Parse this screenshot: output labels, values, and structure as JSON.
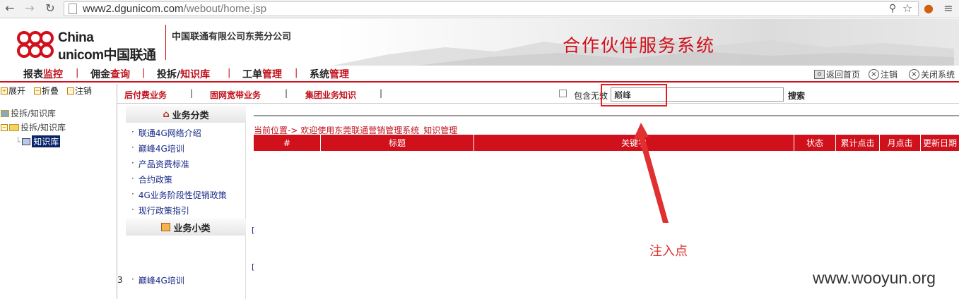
{
  "browser": {
    "url_host": "www2.dgunicom.com",
    "url_path": "/webout/home.jsp"
  },
  "header": {
    "logo_line1": "China",
    "logo_line2": "unicom中国联通",
    "company": "中国联通有限公司东莞分公司",
    "system_title": "合作伙伴服务系统"
  },
  "main_nav": {
    "items": [
      {
        "a": "报表",
        "b": "监控"
      },
      {
        "a": "佣金",
        "b": "查询"
      },
      {
        "a": "投拆/",
        "b": "知识库"
      },
      {
        "a": "工单",
        "b": "管理"
      },
      {
        "a": "系统",
        "b": "管理"
      }
    ],
    "sep": "|",
    "right_links": [
      "返回首页",
      "注销",
      "关闭系统"
    ]
  },
  "tree": {
    "toolbar": [
      "展开",
      "折叠",
      "注销"
    ],
    "nodes": [
      "投拆/知识库",
      "投拆/知识库",
      "知识库"
    ]
  },
  "sub_nav": {
    "items": [
      "后付费业务",
      "固网宽带业务",
      "集团业务知识"
    ],
    "sep": "|",
    "checkbox_label": "包含无效",
    "search_value": "巅峰",
    "search_button": "搜索"
  },
  "categories": {
    "head1": "业务分类",
    "items": [
      "联通4G网络介绍",
      "巅峰4G培训",
      "产品资费标准",
      "合约政策",
      "4G业务阶段性促销政策",
      "现行政策指引"
    ],
    "head2": "业务小类",
    "sub_items": [
      "巅峰4G培训"
    ],
    "bullet": "·"
  },
  "content": {
    "breadcrumb": "当前位置-> 欢迎使用东莞联通营销管理系统_知识管理",
    "columns": [
      "#",
      "标题",
      "关键字",
      "状态",
      "累计点击",
      "月点击",
      "更新日期"
    ]
  },
  "annotation": {
    "label": "注入点",
    "watermark": "www.wooyun.org",
    "side_number": "3"
  },
  "colors": {
    "brand_red": "#d0101b",
    "annot_red": "#e03030"
  }
}
